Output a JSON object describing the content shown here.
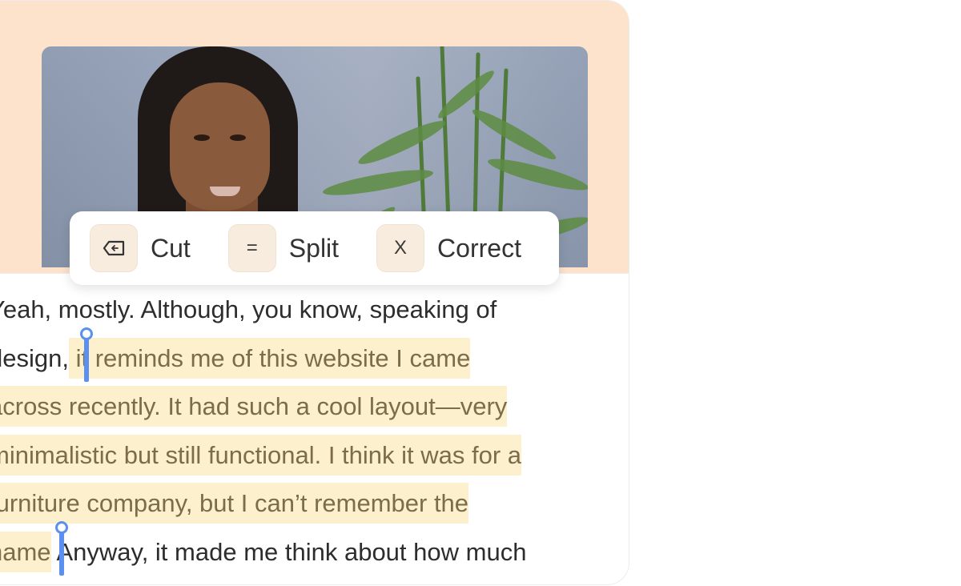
{
  "editor": {
    "video": {
      "alt": "Video frame of a woman with braided hair speaking in front of a plant"
    },
    "toolbar": {
      "items": [
        {
          "label": "Cut",
          "key": "⌫",
          "icon": "backspace-icon"
        },
        {
          "label": "Split",
          "key": "=",
          "icon": "equals-icon"
        },
        {
          "label": "Correct",
          "key": "X",
          "icon": "x-key-icon"
        }
      ]
    },
    "transcript": {
      "lines": [
        {
          "plain_before": "Yeah, mostly. Although, you know, speaking of",
          "highlight": "",
          "plain_after": ""
        },
        {
          "plain_before": "design,",
          "highlight": " it reminds me of this website I came ",
          "plain_after": ""
        },
        {
          "plain_before": "",
          "highlight": "across recently. It had such a cool layout—very ",
          "plain_after": ""
        },
        {
          "plain_before": "",
          "highlight": "minimalistic but still functional. I think it was for a",
          "plain_after": ""
        },
        {
          "plain_before": "",
          "highlight": "furniture company, but I can’t remember the ",
          "plain_after": ""
        },
        {
          "plain_before": "",
          "highlight": "name",
          "plain_after": " Anyway, it made me think about how much"
        }
      ]
    },
    "colors": {
      "accent": "#5b8ff0",
      "highlight": "#fdf1cd",
      "hero_bg": "#fde2cc",
      "key_bg": "#f8ecdf"
    }
  }
}
